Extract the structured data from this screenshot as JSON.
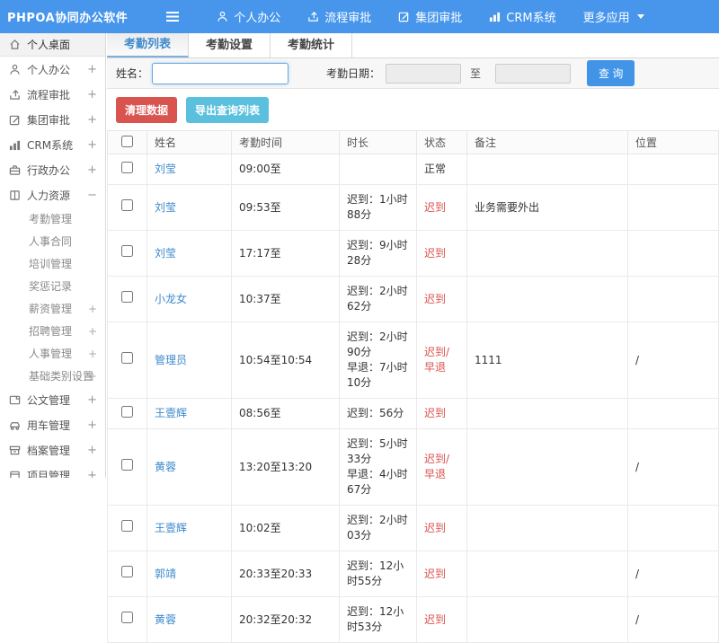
{
  "colors": {
    "navbar_blue": "#4796ec",
    "primary_blue": "#4294e7",
    "danger_red": "#d9534f",
    "info_cyan": "#5bc0de",
    "link_blue": "#3e8acc",
    "status_red": "#d9534f"
  },
  "navbar": {
    "logo": "PHPOA协同办公软件",
    "items": [
      {
        "label": "个人办公",
        "icon": "person-icon"
      },
      {
        "label": "流程审批",
        "icon": "workflow-icon"
      },
      {
        "label": "集团审批",
        "icon": "edit-icon"
      },
      {
        "label": "CRM系统",
        "icon": "chart-icon"
      },
      {
        "label": "更多应用",
        "icon": "caret-down-icon"
      }
    ]
  },
  "sidebar": {
    "items": [
      {
        "label": "个人桌面",
        "icon": "home-icon",
        "active": true,
        "expand": ""
      },
      {
        "label": "个人办公",
        "icon": "person-icon",
        "expand": "+"
      },
      {
        "label": "流程审批",
        "icon": "workflow-icon",
        "expand": "+"
      },
      {
        "label": "集团审批",
        "icon": "edit-icon",
        "expand": "+"
      },
      {
        "label": "CRM系统",
        "icon": "chart-icon",
        "expand": "+"
      },
      {
        "label": "行政办公",
        "icon": "briefcase-icon",
        "expand": "+"
      },
      {
        "label": "人力资源",
        "icon": "book-icon",
        "expand": "−",
        "children": [
          {
            "label": "考勤管理",
            "expand": ""
          },
          {
            "label": "人事合同",
            "expand": ""
          },
          {
            "label": "培训管理",
            "expand": ""
          },
          {
            "label": "奖惩记录",
            "expand": ""
          },
          {
            "label": "薪资管理",
            "expand": "+"
          },
          {
            "label": "招聘管理",
            "expand": "+"
          },
          {
            "label": "人事管理",
            "expand": "+"
          },
          {
            "label": "基础类别设置",
            "expand": "+"
          }
        ]
      },
      {
        "label": "公文管理",
        "icon": "document-icon",
        "expand": "+"
      },
      {
        "label": "用车管理",
        "icon": "car-icon",
        "expand": "+"
      },
      {
        "label": "档案管理",
        "icon": "archive-icon",
        "expand": "+"
      },
      {
        "label": "项目管理",
        "icon": "project-icon",
        "expand": "+"
      }
    ]
  },
  "tabs": [
    {
      "label": "考勤列表",
      "active": true
    },
    {
      "label": "考勤设置",
      "active": false
    },
    {
      "label": "考勤统计",
      "active": false
    }
  ],
  "filter": {
    "name_label": "姓名：",
    "name_value": "",
    "date_label": "考勤日期：",
    "date_from_value": "",
    "to_label": "至",
    "date_to_value": "",
    "search_label": "查 询"
  },
  "actions": {
    "clean_label": "清理数据",
    "export_label": "导出查询列表"
  },
  "table": {
    "headers": [
      "姓名",
      "考勤时间",
      "时长",
      "状态",
      "备注",
      "位置"
    ],
    "rows": [
      {
        "name": "刘莹",
        "time": "09:00至",
        "duration": [],
        "status": "正常",
        "status_type": "ok",
        "note": "",
        "location": ""
      },
      {
        "name": "刘莹",
        "time": "09:53至",
        "duration": [
          "迟到：1小时88分"
        ],
        "status": "迟到",
        "status_type": "late",
        "note": "业务需要外出",
        "location": ""
      },
      {
        "name": "刘莹",
        "time": "17:17至",
        "duration": [
          "迟到：9小时28分"
        ],
        "status": "迟到",
        "status_type": "late",
        "note": "",
        "location": ""
      },
      {
        "name": "小龙女",
        "time": "10:37至",
        "duration": [
          "迟到：2小时62分"
        ],
        "status": "迟到",
        "status_type": "late",
        "note": "",
        "location": ""
      },
      {
        "name": "管理员",
        "time": "10:54至10:54",
        "duration": [
          "迟到：2小时90分",
          "早退：7小时10分"
        ],
        "status": "迟到/早退",
        "status_type": "late",
        "note": "1111",
        "location": "/"
      },
      {
        "name": "王壹辉",
        "time": "08:56至",
        "duration": [
          "迟到：56分"
        ],
        "status": "迟到",
        "status_type": "late",
        "note": "",
        "location": ""
      },
      {
        "name": "黄蓉",
        "time": "13:20至13:20",
        "duration": [
          "迟到：5小时33分",
          "早退：4小时67分"
        ],
        "status": "迟到/早退",
        "status_type": "late",
        "note": "",
        "location": "/"
      },
      {
        "name": "王壹辉",
        "time": "10:02至",
        "duration": [
          "迟到：2小时03分"
        ],
        "status": "迟到",
        "status_type": "late",
        "note": "",
        "location": ""
      },
      {
        "name": "郭靖",
        "time": "20:33至20:33",
        "duration": [
          "迟到：12小时55分"
        ],
        "status": "迟到",
        "status_type": "late",
        "note": "",
        "location": "/"
      },
      {
        "name": "黄蓉",
        "time": "20:32至20:32",
        "duration": [
          "迟到：12小时53分"
        ],
        "status": "迟到",
        "status_type": "late",
        "note": "",
        "location": "/"
      }
    ]
  }
}
